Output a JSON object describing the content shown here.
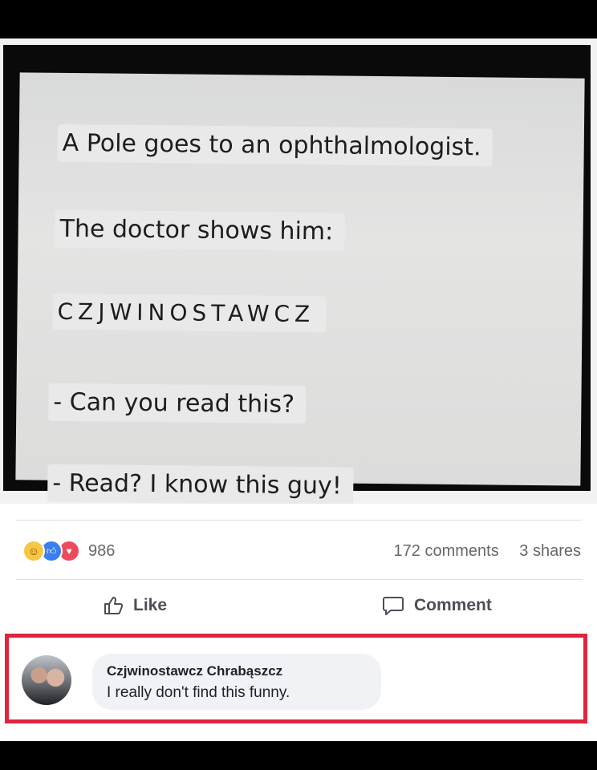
{
  "joke": {
    "line1": "A Pole goes to an ophthalmologist.",
    "line2": "The doctor shows him:",
    "line3": "CZJWINOSTAWCZ",
    "line4": "- Can you read this?",
    "line5": "- Read? I know this guy!"
  },
  "post": {
    "reaction_icons": [
      "haha-icon",
      "like-icon",
      "love-icon"
    ],
    "reaction_count": "986",
    "comments_count": "172 comments",
    "shares_count": "3 shares",
    "like_label": "Like",
    "comment_label": "Comment"
  },
  "comment": {
    "author": "Czjwinostawcz Chrabąszcz",
    "text": "I really don't find this funny."
  },
  "colors": {
    "highlight_border": "#e0243e",
    "like_blue": "#3b7ef0",
    "love_red": "#ec4a5d",
    "haha_yellow": "#f7c744"
  }
}
